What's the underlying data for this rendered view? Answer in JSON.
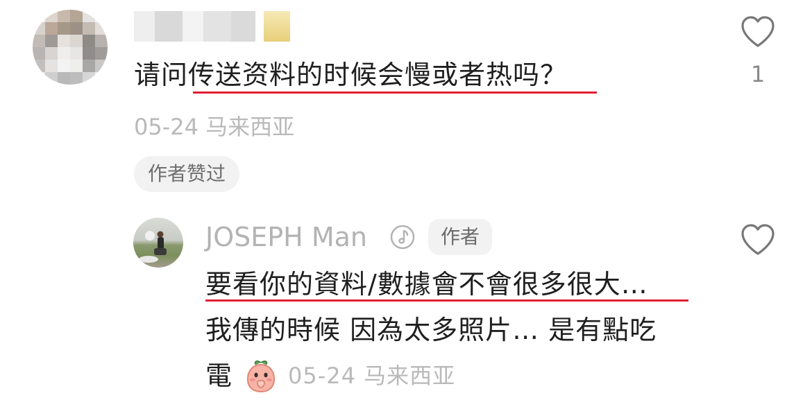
{
  "comment": {
    "text": "请问传送资料的时候会慢或者热吗？",
    "date": "05-24",
    "location": "马来西亚",
    "author_liked_label": "作者赞过",
    "like_count": "1"
  },
  "reply": {
    "username": "JOSEPH Man",
    "author_tag": "作者",
    "line1": "要看你的資料/數據會不會很多很大…",
    "line2": "我傳的時候 因為太多照片… 是有點吃",
    "line3": "電",
    "date": "05-24",
    "location": "马来西亚",
    "emoji": "peach-face-emoji"
  },
  "colors": {
    "underline": "#e01e34",
    "meta_text": "#b9b9b9",
    "body_text": "#1f1f1f"
  }
}
